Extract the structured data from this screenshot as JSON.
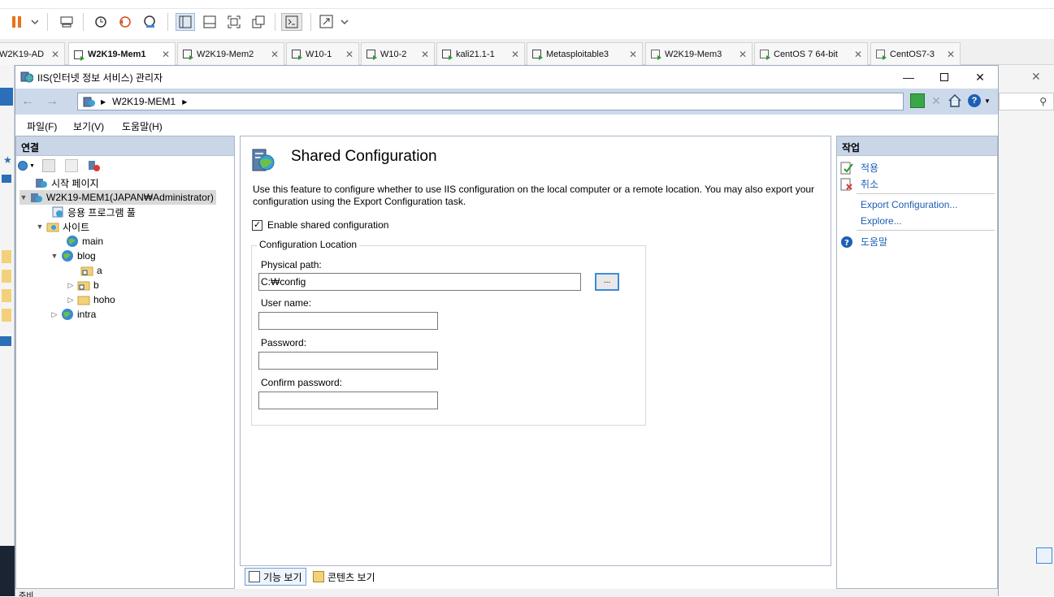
{
  "vm_tabs": [
    {
      "label": "W2K19-AD"
    },
    {
      "label": "W2K19-Mem1"
    },
    {
      "label": "W2K19-Mem2"
    },
    {
      "label": "W10-1"
    },
    {
      "label": "W10-2"
    },
    {
      "label": "kali21.1-1"
    },
    {
      "label": "Metasploitable3"
    },
    {
      "label": "W2K19-Mem3"
    },
    {
      "label": "CentOS 7 64-bit"
    },
    {
      "label": "CentOS7-3"
    }
  ],
  "window": {
    "title": "IIS(인터넷 정보 서비스) 관리자",
    "address_path": "W2K19-MEM1"
  },
  "menu": [
    "파일(F)",
    "보기(V)",
    "도움말(H)"
  ],
  "connections": {
    "header": "연결",
    "tree": [
      {
        "label": "시작 페이지"
      },
      {
        "label": "W2K19-MEM1(JAPAN₩Administrator)"
      },
      {
        "label": "응용 프로그램 풀"
      },
      {
        "label": "사이트"
      },
      {
        "label": "main"
      },
      {
        "label": "blog"
      },
      {
        "label": "a"
      },
      {
        "label": "b"
      },
      {
        "label": "hoho"
      },
      {
        "label": "intra"
      }
    ]
  },
  "main": {
    "title": "Shared Configuration",
    "description": "Use this feature to configure whether to use IIS configuration on the local computer or a remote location. You may also export your configuration using the Export Configuration task.",
    "enable_label": "Enable shared configuration",
    "enable_checked": true,
    "check_mark": "✓",
    "group_label": "Configuration Location",
    "physical_path_label": "Physical path:",
    "physical_path_value": "C:₩config",
    "browse_label": "...",
    "user_name_label": "User name:",
    "user_name_value": "",
    "password_label": "Password:",
    "password_value": "",
    "confirm_password_label": "Confirm password:",
    "confirm_password_value": ""
  },
  "view_tabs": {
    "features": "기능 보기",
    "content": "콘텐츠 보기"
  },
  "actions": {
    "header": "작업",
    "apply": "적용",
    "cancel": "취소",
    "export": "Export Configuration...",
    "explore": "Explore...",
    "help": "도움말"
  },
  "status": {
    "text": "준비"
  },
  "colors": {
    "accent": "#1d5fb5",
    "header_bg": "#c9d6e8",
    "address_bar_bg": "#ccd9ea"
  }
}
